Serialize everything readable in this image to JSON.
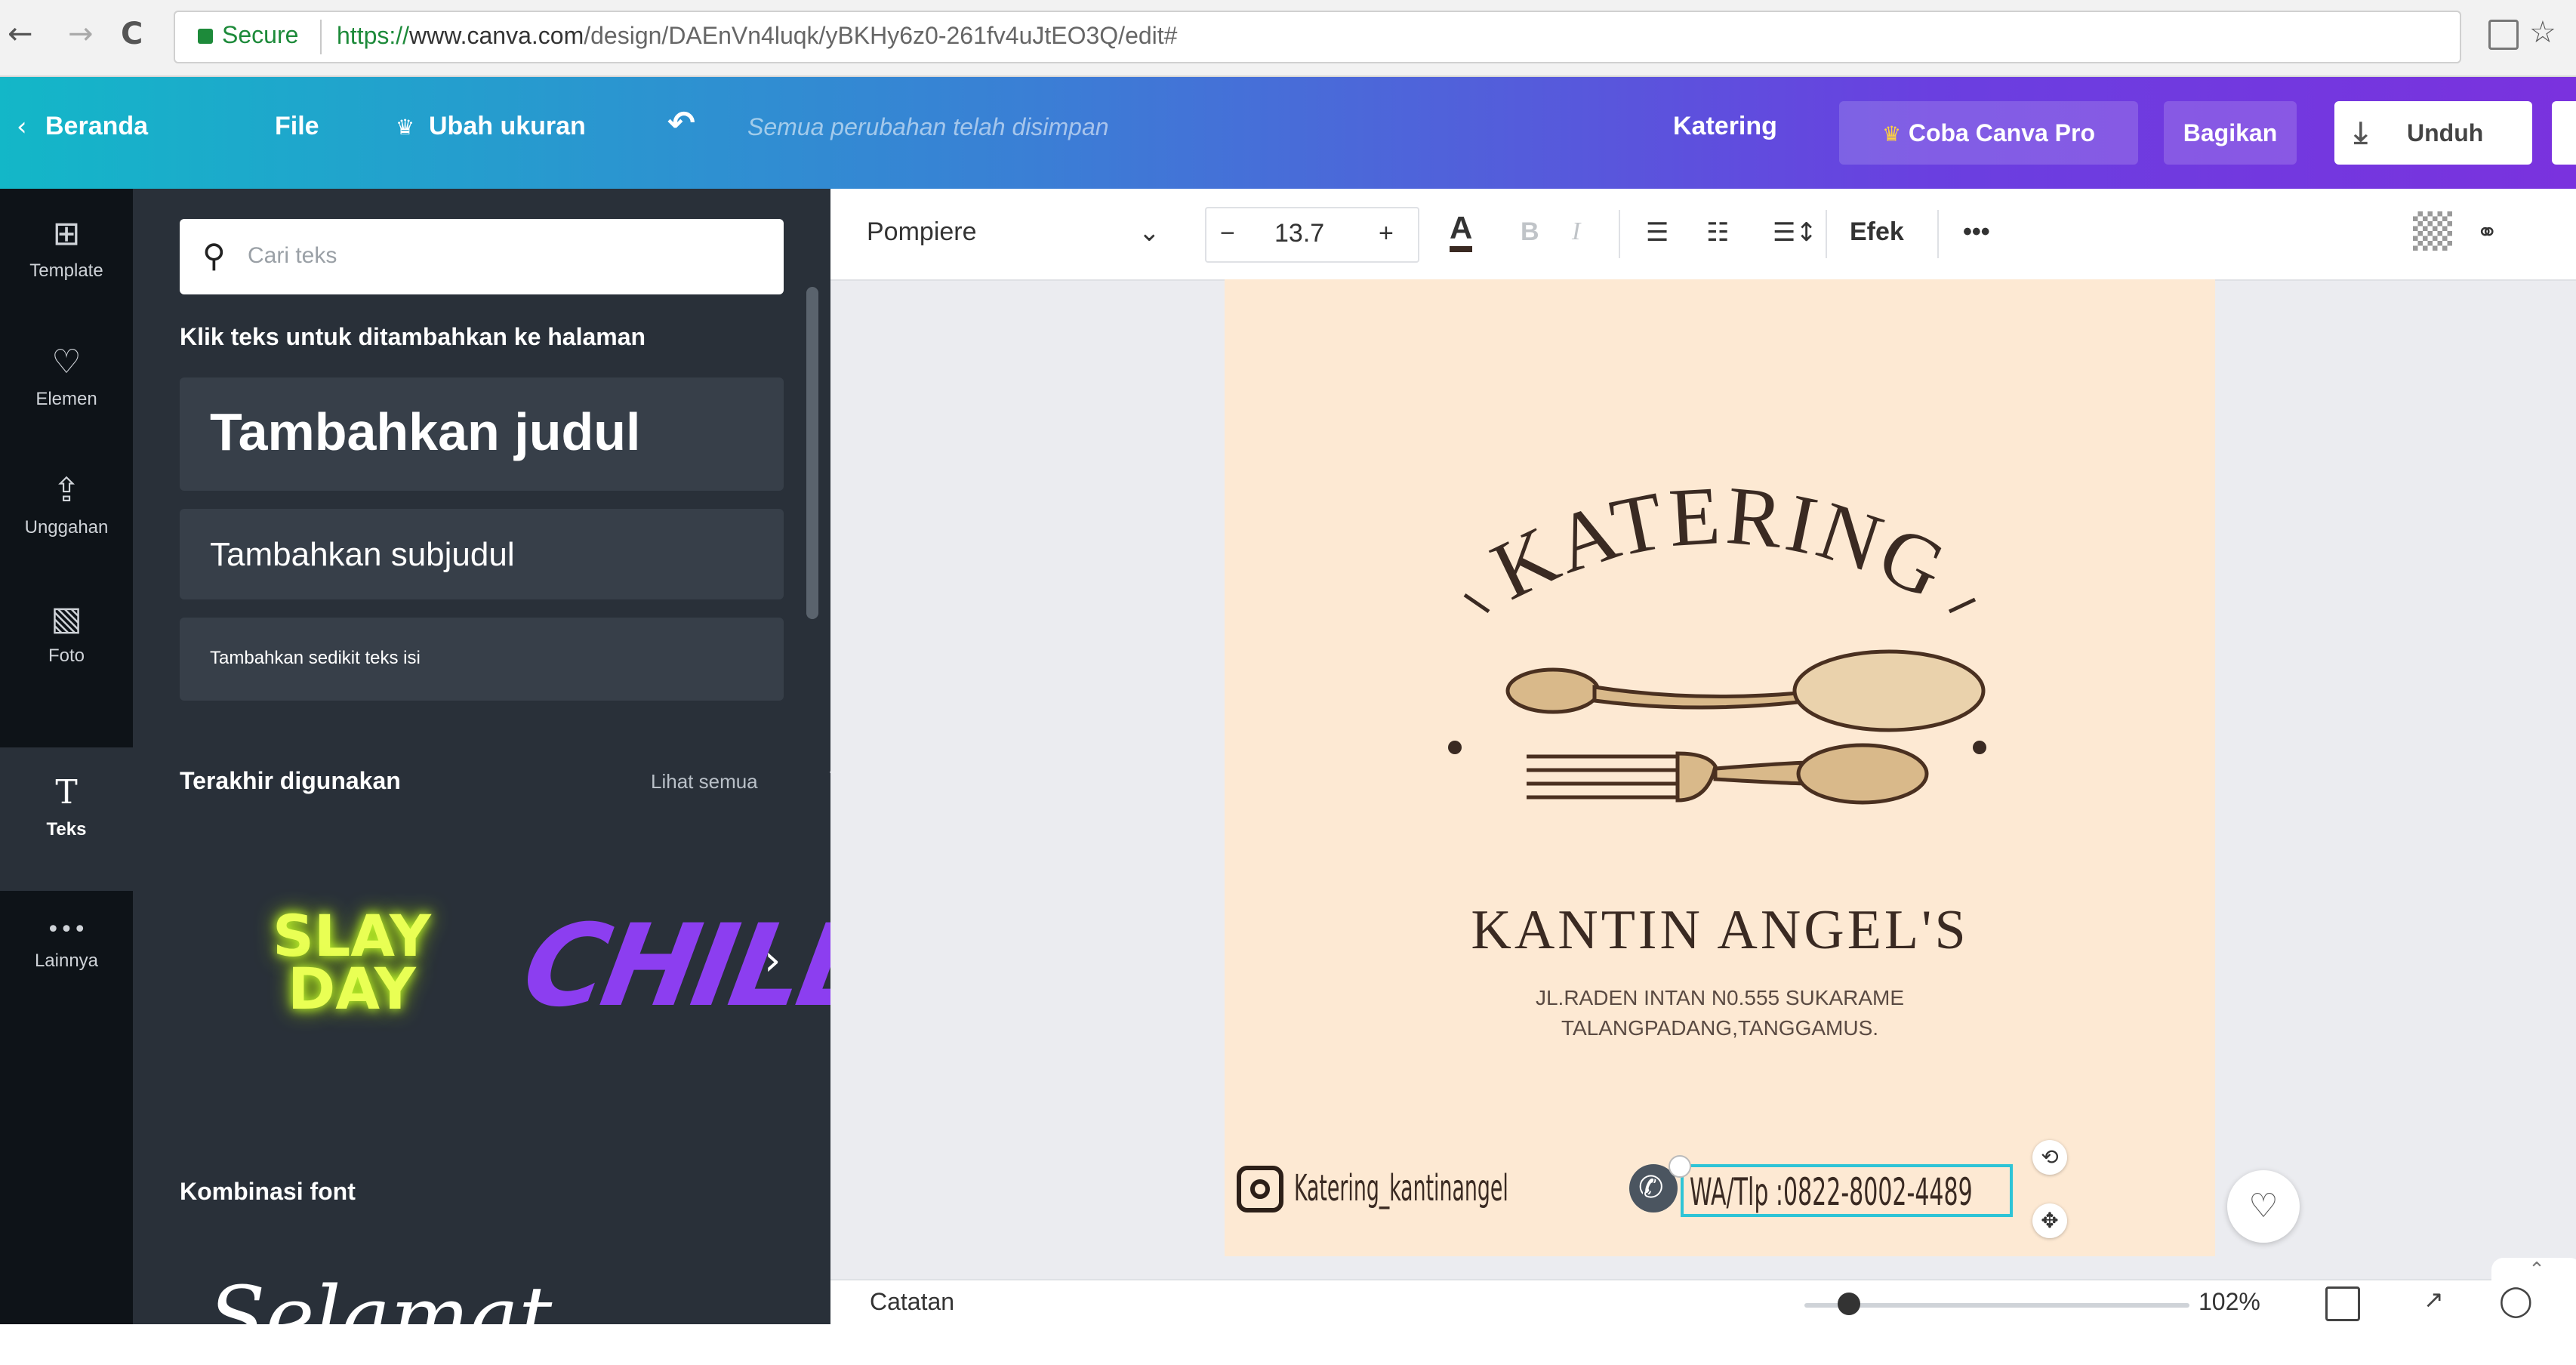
{
  "browser": {
    "back": "←",
    "forward": "→",
    "reload": "C",
    "secure_label": "Secure",
    "url_scheme": "https://",
    "url_host": "www.canva.com",
    "url_path": "/design/DAEnVn4luqk/yBKHy6z0-261fv4uJtEO3Q/edit#",
    "star": "☆"
  },
  "header": {
    "back_label": "Beranda",
    "file_label": "File",
    "resize_label": "Ubah ukuran",
    "undo_glyph": "↶",
    "saved_status": "Semua perubahan telah disimpan",
    "design_title": "Katering",
    "pro_label": "Coba Canva Pro",
    "share_label": "Bagikan",
    "download_label": "Unduh"
  },
  "rail": [
    {
      "icon": "⊞",
      "label": "Template"
    },
    {
      "icon": "♡",
      "label": "Elemen"
    },
    {
      "icon": "⇪",
      "label": "Unggahan"
    },
    {
      "icon": "▧",
      "label": "Foto"
    },
    {
      "icon": "T",
      "label": "Teks"
    },
    {
      "icon": "•••",
      "label": "Lainnya"
    }
  ],
  "panel": {
    "search_placeholder": "Cari teks",
    "instruction": "Klik teks untuk ditambahkan ke halaman",
    "add_heading": "Tambahkan judul",
    "add_subheading": "Tambahkan subjudul",
    "add_body": "Tambahkan sedikit teks isi",
    "recent_heading": "Terakhir digunakan",
    "see_all": "Lihat semua",
    "recent_1_line1": "SLAY",
    "recent_1_line2": "DAY",
    "recent_2": "CHILL",
    "font_combos_heading": "Kombinasi font",
    "combo_preview": "Selamat"
  },
  "toolbar": {
    "font_name": "Pompiere",
    "font_size": "13.7",
    "minus": "−",
    "plus": "+",
    "text_color_glyph": "A",
    "bold": "B",
    "italic": "I",
    "effects_label": "Efek",
    "more": "•••"
  },
  "design": {
    "title": "KATERING",
    "name": "KANTIN ANGEL'S",
    "address_line1": "JL.RADEN INTAN N0.555 SUKARAME",
    "address_line2": "TALANGPADANG,TANGGAMUS.",
    "instagram": "Katering_kantinangel",
    "phone": "WA/Tlp :0822-8002-4489"
  },
  "bottom": {
    "notes_label": "Catatan",
    "zoom_level": 102,
    "zoom": "102%"
  },
  "colors": {
    "page_bg": "#fde9d3",
    "header_gradient_start": "#13b7c8",
    "header_gradient_end": "#7a32de",
    "ink": "#3a2a22",
    "selection": "#2ec4d6"
  }
}
